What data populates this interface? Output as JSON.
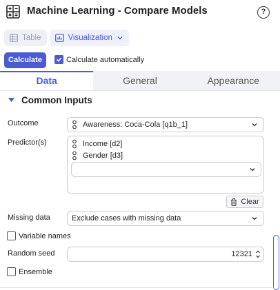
{
  "header": {
    "title": "Machine Learning - Compare Models",
    "help_label": "?"
  },
  "view_toggle": {
    "table_label": "Table",
    "visualization_label": "Visualization",
    "active": "visualization"
  },
  "calculate": {
    "button_label": "Calculate",
    "auto_label": "Calculate automatically",
    "auto_checked": true
  },
  "tabs": [
    {
      "label": "Data",
      "active": true
    },
    {
      "label": "General",
      "active": false
    },
    {
      "label": "Appearance",
      "active": false
    }
  ],
  "section": {
    "title": "Common Inputs",
    "expanded": true
  },
  "outcome": {
    "label": "Outcome",
    "value": "Awareness: Coca-Cola [q1b_1]"
  },
  "predictors": {
    "label": "Predictor(s)",
    "items": [
      "Income [d2]",
      "Gender [d3]"
    ],
    "add_placeholder": "",
    "clear_label": "Clear"
  },
  "missing_data": {
    "label": "Missing data",
    "value": "Exclude cases with missing data"
  },
  "variable_names": {
    "label": "Variable names",
    "checked": false
  },
  "random_seed": {
    "label": "Random seed",
    "value": "12321"
  },
  "ensemble": {
    "label": "Ensemble",
    "checked": false
  },
  "colors": {
    "accent": "#4a5bd4",
    "tab_bg": "#f1f2f5",
    "border": "#c9ccd6"
  }
}
